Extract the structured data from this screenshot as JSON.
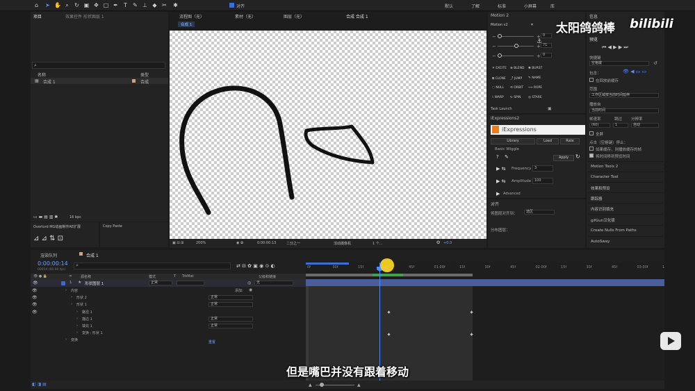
{
  "toolbar": {
    "align_label": "对齐",
    "workspaces": [
      "默认",
      "了解",
      "标准",
      "小屏幕",
      "库"
    ]
  },
  "watermark": {
    "channel": "太阳鸽鸽棒",
    "brand": "bilibili"
  },
  "project": {
    "tab": "项目",
    "effects_tab": "效果控件 形状图层 1",
    "search_icon": "search-icon",
    "col_name": "名称",
    "col_type": "类型",
    "item_name": "合成 1",
    "item_type": "合成",
    "bpc": "16 bpc"
  },
  "extensions": {
    "overlord": "Overlord MG动画制作AE扩展",
    "copy_paste": "Copy Paste"
  },
  "viewer": {
    "tabs": [
      "流程图（无）",
      "素材（无）",
      "图层（无）"
    ],
    "comp_tab": "合成 合成 1",
    "comp_label": "合成 1",
    "zoom": "200%",
    "timecode": "0:00:00:13",
    "resolution": "二分之一",
    "camera": "活动摄像机",
    "views": "1 个...",
    "exposure": "+0.0"
  },
  "motion": {
    "title": "Motion 2",
    "version": "Motion v2",
    "val1": "0",
    "val2": "71",
    "val3": "0",
    "buttons": [
      [
        "EXCITE",
        "BLEND",
        "BURST"
      ],
      [
        "CLONE",
        "JUMP",
        "NAME"
      ],
      [
        "NULL",
        "ORBIT",
        "ROPE"
      ],
      [
        "WARP",
        "SPIN",
        "STARE"
      ]
    ],
    "tasklaunch": "Task Launch"
  },
  "iexp": {
    "tab": "iExpressions2",
    "title": "iExpressions",
    "lib": "Library",
    "load": "Load",
    "rate": "Rate",
    "basic": "Basic Wiggle",
    "apply": "Apply",
    "freq_label": "Frequency",
    "freq_val": "3",
    "amp_label": "Amplitude",
    "amp_val": "100",
    "advanced": "Advanced"
  },
  "align": {
    "tab": "对齐",
    "align_to": "将图层对齐到：",
    "align_target": "选区",
    "distribute": "分布图层："
  },
  "right": {
    "info": "信息",
    "preview": "预览",
    "shortcut_label": "快捷键",
    "shortcut": "空格键",
    "include": "包含：",
    "cache": "在回放前缓存",
    "range_label": "范围",
    "range": "工作区域按当前时间延伸",
    "play_label": "播放自",
    "play": "当前时间",
    "fps_label": "帧速率",
    "skip_label": "跳过",
    "res_label": "分辨率",
    "fps": "(60)",
    "skip": "1",
    "res": "自动",
    "fullscreen": "全屏",
    "stop_note": "点击（空格键）停止：",
    "opt1": "如果缓存，则播放缓存的帧",
    "opt2": "将时间移到预览时间",
    "items": [
      "Motion Tools 2",
      "Character Tool",
      "效果和预设",
      "跟踪器",
      "内容识别填充",
      "gifGun汉化版",
      "Create Nulls From Paths",
      "AutoSway"
    ]
  },
  "timeline": {
    "render_tab": "渲染队列",
    "comp_tab": "合成 1",
    "time": "0:00:00:14",
    "frames": "00014 (60.00 fps)",
    "headers": {
      "src": "源名称",
      "mode": "模式",
      "t": "T",
      "trk": "TrkMat",
      "parent": "父级和链接"
    },
    "layer": {
      "num": "1",
      "name": "形状图层 1",
      "mode": "正常",
      "parent": "无"
    },
    "add": "添加:",
    "rows": [
      "内容",
      "形状 2",
      "形状 1",
      "路径 1",
      "描边 1",
      "填充 1",
      "变换 : 形状 1",
      "变换"
    ],
    "modes": [
      "正常",
      "正常",
      "正常",
      "正常"
    ],
    "reset": "重置",
    "ruler": [
      "0f",
      "00f",
      "15f",
      "30f",
      "45f",
      "01:00f",
      "15f",
      "30f",
      "45f",
      "02:00f",
      "15f",
      "30f",
      "45f",
      "03:00f",
      "15f",
      "30f"
    ]
  },
  "subtitle": "但是嘴巴并没有跟着移动"
}
